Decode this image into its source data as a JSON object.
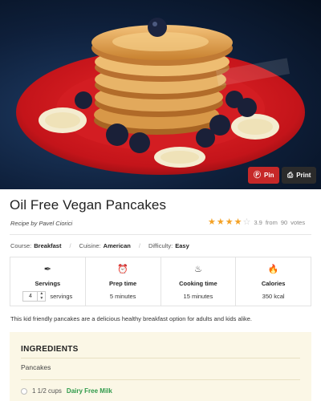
{
  "hero": {
    "pin_label": "Pin",
    "print_label": "Print"
  },
  "recipe": {
    "title": "Oil Free Vegan Pancakes",
    "author_prefix": "Recipe by",
    "author_name": "Pavel Ciorici",
    "rating_value": "3.9",
    "rating_from": "from",
    "rating_votes": "90",
    "rating_votes_label": "votes",
    "rating_stars_filled": 4,
    "description": "This kid friendly pancakes are a delicious healthy breakfast option for adults and kids alike."
  },
  "meta": {
    "course_label": "Course:",
    "course_value": "Breakfast",
    "cuisine_label": "Cuisine:",
    "cuisine_value": "American",
    "difficulty_label": "Difficulty:",
    "difficulty_value": "Easy"
  },
  "stats": {
    "servings_label": "Servings",
    "servings_value": "4",
    "servings_unit": "servings",
    "prep_label": "Prep time",
    "prep_value": "5 minutes",
    "cooking_label": "Cooking time",
    "cooking_value": "15 minutes",
    "calories_label": "Calories",
    "calories_value": "350 kcal"
  },
  "ingredients": {
    "heading": "INGREDIENTS",
    "group": "Pancakes",
    "items": [
      {
        "amount": "1 1/2 cups",
        "name": "Dairy Free Milk"
      }
    ]
  },
  "colors": {
    "star": "#f4a124",
    "pin": "#c62828",
    "link": "#2e9a4a",
    "ingredients_bg": "#fbf7e6"
  }
}
